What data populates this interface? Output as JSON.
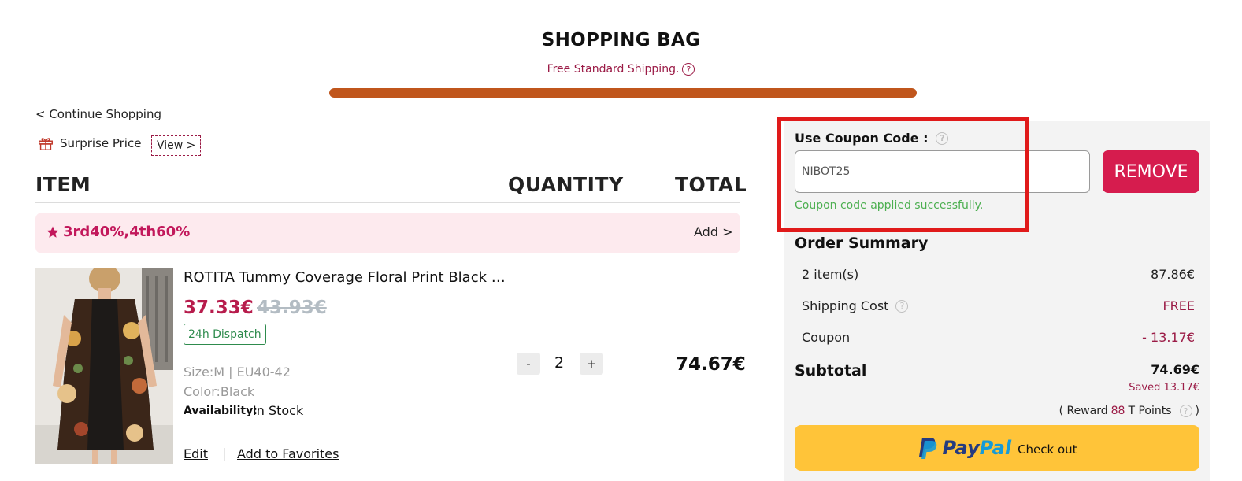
{
  "header": {
    "title": "SHOPPING BAG",
    "shipping_note": "Free Standard Shipping.",
    "shipping_progress": 1.0
  },
  "nav": {
    "continue_shopping": "< Continue Shopping",
    "surprise_label": "Surprise Price",
    "view_label": "View >"
  },
  "table": {
    "col_item": "ITEM",
    "col_quantity": "QUANTITY",
    "col_total": "TOTAL"
  },
  "promo": {
    "label": "3rd40%,4th60%",
    "add_label": "Add >"
  },
  "item": {
    "name": "ROTITA Tummy Coverage Floral Print Black Dress",
    "price": "37.33€",
    "original_price": "43.93€",
    "badge": "24h Dispatch",
    "size": "Size:M | EU40-42",
    "color": "Color:Black",
    "availability_label": "Availability:",
    "availability_value": "In Stock",
    "edit_label": "Edit",
    "separator": "|",
    "favorites_label": "Add to Favorites",
    "qty_minus": "-",
    "qty_plus": "+",
    "quantity": "2",
    "total": "74.67€"
  },
  "coupon": {
    "label": "Use Coupon Code :",
    "help": "?",
    "value": "NIBOT25",
    "remove_label": "REMOVE",
    "success_message": "Coupon code applied successfully."
  },
  "summary": {
    "title": "Order Summary",
    "items_label": "2 item(s)",
    "items_value": "87.86€",
    "shipping_label": "Shipping Cost",
    "shipping_value": "FREE",
    "coupon_label": "Coupon",
    "coupon_value": "- 13.17€",
    "subtotal_label": "Subtotal",
    "subtotal_value": "74.69€",
    "saved_text": "Saved 13.17€",
    "reward_prefix": "( Reward",
    "reward_points": "88",
    "reward_suffix": "T Points",
    "reward_close": ")"
  },
  "checkout": {
    "paypal_pay": "Pay",
    "paypal_pal": "Pal",
    "checkout_label": "Check out"
  },
  "colors": {
    "brand": "#9b1b46",
    "progress": "#c0561c",
    "remove_button": "#d61c4e",
    "success": "#4caf50",
    "highlight": "#e01a1a",
    "paypal_button": "#ffc439"
  }
}
